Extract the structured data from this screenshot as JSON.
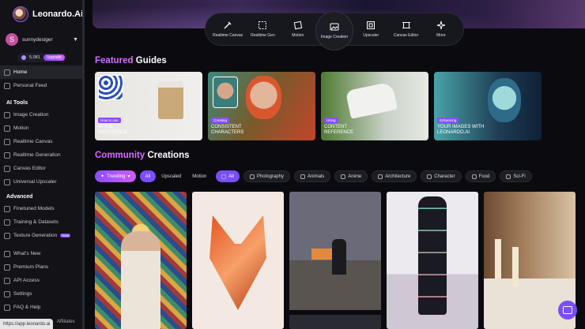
{
  "brand": {
    "name": "Leonardo.Ai"
  },
  "user": {
    "initial": "S",
    "name": "sunnydesiger"
  },
  "credits": {
    "value": "5,081",
    "upgrade_label": "Upgrade"
  },
  "nav_top": [
    {
      "label": "Home"
    },
    {
      "label": "Personal Feed"
    }
  ],
  "ai_tools": {
    "title": "AI Tools",
    "items": [
      {
        "label": "Image Creation"
      },
      {
        "label": "Motion"
      },
      {
        "label": "Realtime Canvas"
      },
      {
        "label": "Realtime Generation"
      },
      {
        "label": "Canvas Editor"
      },
      {
        "label": "Universal Upscaler"
      }
    ]
  },
  "advanced": {
    "title": "Advanced",
    "items": [
      {
        "label": "Finetuned Models"
      },
      {
        "label": "Training & Datasets"
      },
      {
        "label": "Texture Generation",
        "badge": "New"
      }
    ]
  },
  "nav_bottom": [
    {
      "label": "What's New"
    },
    {
      "label": "Premium Plans"
    },
    {
      "label": "API Access"
    },
    {
      "label": "Settings"
    },
    {
      "label": "FAQ & Help"
    }
  ],
  "status": {
    "url": "https://app.leonardo.ai",
    "affiliates": "Affiliates"
  },
  "toolbar": [
    {
      "label": "Realtime Canvas"
    },
    {
      "label": "Realtime Gen"
    },
    {
      "label": "Motion"
    },
    {
      "label": "Image Creation"
    },
    {
      "label": "Upscaler"
    },
    {
      "label": "Canvas Editor"
    },
    {
      "label": "More"
    }
  ],
  "featured": {
    "accent": "Featured",
    "rest": " Guides",
    "cards": [
      {
        "tag": "How to use",
        "title1": "Style",
        "title2": "Reference"
      },
      {
        "tag": "Creating",
        "title1": "Consistent",
        "title2": "Characters"
      },
      {
        "tag": "Using",
        "title1": "Content",
        "title2": "Reference"
      },
      {
        "tag": "Enhancing",
        "title1": "Your images with",
        "title2": "Leonardo.Ai"
      }
    ]
  },
  "community": {
    "accent": "Community",
    "rest": " Creations",
    "trending": "Trending",
    "media_filters": [
      "All",
      "Upscaled",
      "Motion"
    ],
    "category_filters": [
      "All",
      "Photography",
      "Animals",
      "Anime",
      "Architecture",
      "Character",
      "Food",
      "Sci-Fi"
    ]
  },
  "colors": {
    "accent": "#d86cff",
    "primary": "#7a4dff",
    "background": "#0b0b0f"
  }
}
